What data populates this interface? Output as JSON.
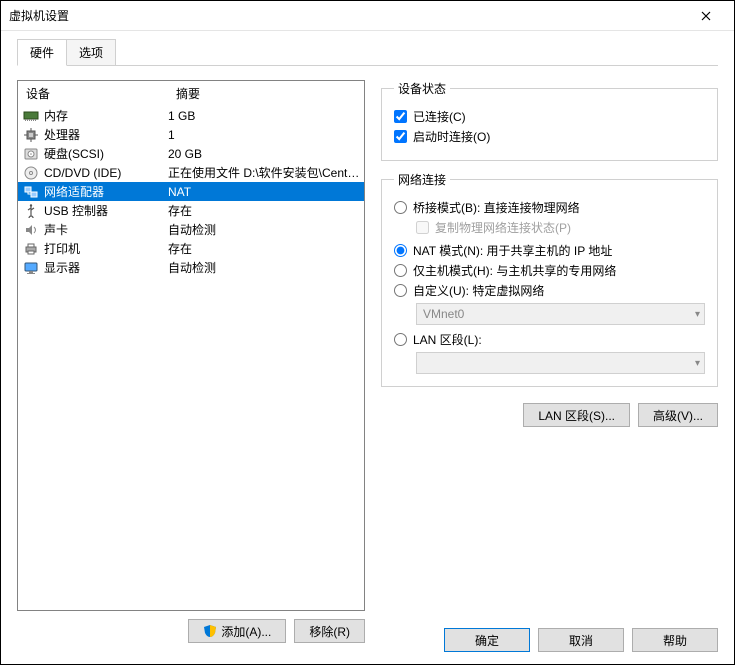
{
  "window": {
    "title": "虚拟机设置"
  },
  "tabs": {
    "hardware": "硬件",
    "options": "选项"
  },
  "headers": {
    "device": "设备",
    "summary": "摘要"
  },
  "devices": [
    {
      "name": "内存",
      "summary": "1 GB"
    },
    {
      "name": "处理器",
      "summary": "1"
    },
    {
      "name": "硬盘(SCSI)",
      "summary": "20 GB"
    },
    {
      "name": "CD/DVD (IDE)",
      "summary": "正在使用文件 D:\\软件安装包\\CentO..."
    },
    {
      "name": "网络适配器",
      "summary": "NAT"
    },
    {
      "name": "USB 控制器",
      "summary": "存在"
    },
    {
      "name": "声卡",
      "summary": "自动检测"
    },
    {
      "name": "打印机",
      "summary": "存在"
    },
    {
      "name": "显示器",
      "summary": "自动检测"
    }
  ],
  "left_buttons": {
    "add": "添加(A)...",
    "remove": "移除(R)"
  },
  "status": {
    "legend": "设备状态",
    "connected": "已连接(C)",
    "connect_at_power": "启动时连接(O)"
  },
  "net": {
    "legend": "网络连接",
    "bridged": "桥接模式(B): 直接连接物理网络",
    "replicate": "复制物理网络连接状态(P)",
    "nat": "NAT 模式(N): 用于共享主机的 IP 地址",
    "hostonly": "仅主机模式(H): 与主机共享的专用网络",
    "custom": "自定义(U): 特定虚拟网络",
    "custom_value": "VMnet0",
    "lan": "LAN 区段(L):",
    "lan_value": ""
  },
  "right_buttons": {
    "lan": "LAN 区段(S)...",
    "advanced": "高级(V)..."
  },
  "bottom": {
    "ok": "确定",
    "cancel": "取消",
    "help": "帮助"
  }
}
